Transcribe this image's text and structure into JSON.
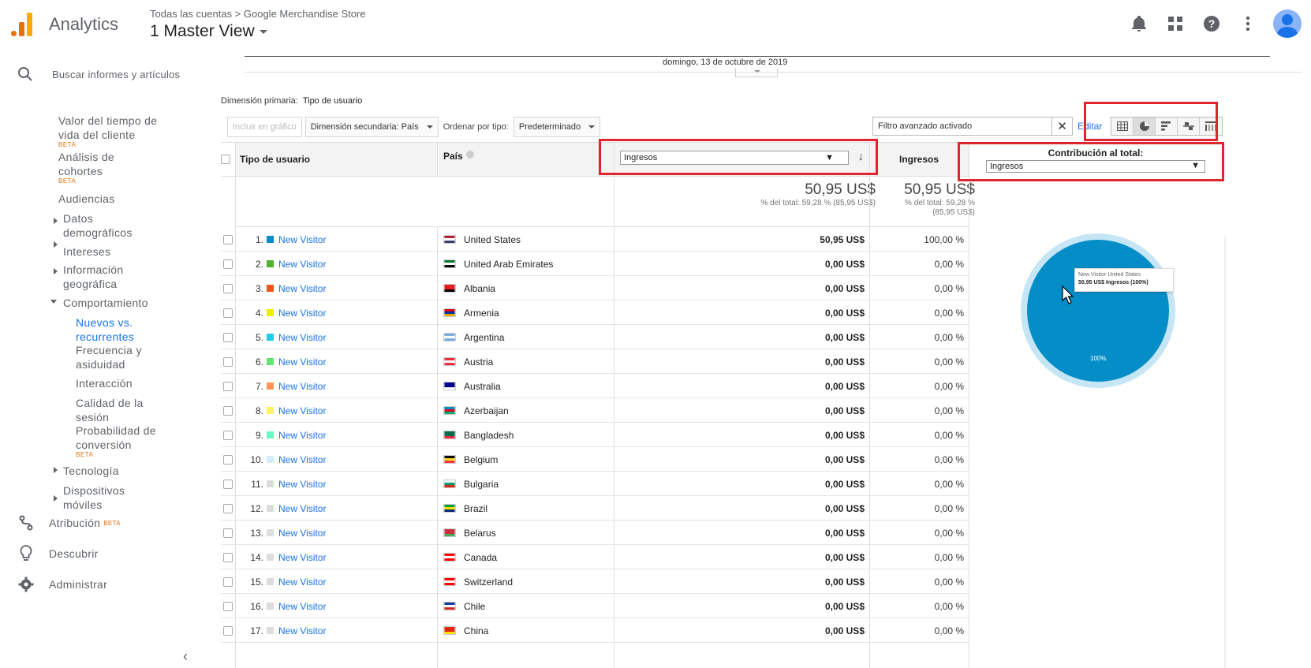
{
  "header": {
    "app_name": "Analytics",
    "breadcrumb": "Todas las cuentas > Google Merchandise Store",
    "view_name": "1 Master View",
    "icons": [
      "bell-icon",
      "apps-grid-icon",
      "help-icon",
      "more-vert-icon",
      "avatar"
    ]
  },
  "sidebar": {
    "search_label": "Buscar informes y artículos",
    "items": [
      {
        "label": "Valor del tiempo de vida del cliente",
        "beta": "BETA"
      },
      {
        "label": "Análisis de cohortes",
        "beta": "BETA"
      },
      {
        "label": "Audiencias"
      },
      {
        "label": "Datos demográficos"
      },
      {
        "label": "Intereses"
      },
      {
        "label": "Información geográfica"
      },
      {
        "label": "Comportamiento"
      },
      {
        "label": "Nuevos vs. recurrentes"
      },
      {
        "label": "Frecuencia y asiduidad"
      },
      {
        "label": "Interacción"
      },
      {
        "label": "Calidad de la sesión"
      },
      {
        "label": "Probabilidad de conversión",
        "beta": "BETA"
      },
      {
        "label": "Tecnología"
      },
      {
        "label": "Dispositivos móviles"
      }
    ],
    "bottom": {
      "attribution": "Atribución",
      "attribution_beta": "BETA",
      "discover": "Descubrir",
      "admin": "Administrar"
    }
  },
  "content": {
    "date_label": "domingo, 13 de octubre de 2019",
    "primary_dimension_label": "Dimensión primaria:",
    "primary_dimension_value": "Tipo de usuario",
    "toolbar": {
      "plot_rows": "Incluir en gráfico",
      "secondary_dimension": "Dimensión secundaria: País",
      "sort_label": "Ordenar por tipo:",
      "sort_value": "Predeterminado",
      "filter_value": "Filtro avanzado activado",
      "edit": "Editar"
    },
    "table": {
      "col_user_type": "Tipo de usuario",
      "col_country": "País",
      "metric_select": "Ingresos",
      "col_revenue": "Ingresos",
      "contrib_title": "Contribución al total:",
      "contrib_select": "Ingresos",
      "total_revenue": "50,95 US$",
      "total_revenue_sub": "% del total: 59,28 % (85,95 US$)",
      "total_revenue2": "50,95 US$",
      "total_revenue2_sub1": "% del total: 59,28 %",
      "total_revenue2_sub2": "(85,95 US$)",
      "rows": [
        {
          "idx": "1.",
          "user": "New Visitor",
          "country": "United States",
          "revenue": "50,95 US$",
          "pct": "100,00 %",
          "color": "#058dc7"
        },
        {
          "idx": "2.",
          "user": "New Visitor",
          "country": "United Arab Emirates",
          "revenue": "0,00 US$",
          "pct": "0,00 %",
          "color": "#50b432"
        },
        {
          "idx": "3.",
          "user": "New Visitor",
          "country": "Albania",
          "revenue": "0,00 US$",
          "pct": "0,00 %",
          "color": "#ed561b"
        },
        {
          "idx": "4.",
          "user": "New Visitor",
          "country": "Armenia",
          "revenue": "0,00 US$",
          "pct": "0,00 %",
          "color": "#edef00"
        },
        {
          "idx": "5.",
          "user": "New Visitor",
          "country": "Argentina",
          "revenue": "0,00 US$",
          "pct": "0,00 %",
          "color": "#24cbe5"
        },
        {
          "idx": "6.",
          "user": "New Visitor",
          "country": "Austria",
          "revenue": "0,00 US$",
          "pct": "0,00 %",
          "color": "#64e572"
        },
        {
          "idx": "7.",
          "user": "New Visitor",
          "country": "Australia",
          "revenue": "0,00 US$",
          "pct": "0,00 %",
          "color": "#ff9655"
        },
        {
          "idx": "8.",
          "user": "New Visitor",
          "country": "Azerbaijan",
          "revenue": "0,00 US$",
          "pct": "0,00 %",
          "color": "#fff263"
        },
        {
          "idx": "9.",
          "user": "New Visitor",
          "country": "Bangladesh",
          "revenue": "0,00 US$",
          "pct": "0,00 %",
          "color": "#6af9c4"
        },
        {
          "idx": "10.",
          "user": "New Visitor",
          "country": "Belgium",
          "revenue": "0,00 US$",
          "pct": "0,00 %",
          "color": "#d6ebfb"
        },
        {
          "idx": "11.",
          "user": "New Visitor",
          "country": "Bulgaria",
          "revenue": "0,00 US$",
          "pct": "0,00 %",
          "color": "#dddddd"
        },
        {
          "idx": "12.",
          "user": "New Visitor",
          "country": "Brazil",
          "revenue": "0,00 US$",
          "pct": "0,00 %",
          "color": "#dddddd"
        },
        {
          "idx": "13.",
          "user": "New Visitor",
          "country": "Belarus",
          "revenue": "0,00 US$",
          "pct": "0,00 %",
          "color": "#dddddd"
        },
        {
          "idx": "14.",
          "user": "New Visitor",
          "country": "Canada",
          "revenue": "0,00 US$",
          "pct": "0,00 %",
          "color": "#dddddd"
        },
        {
          "idx": "15.",
          "user": "New Visitor",
          "country": "Switzerland",
          "revenue": "0,00 US$",
          "pct": "0,00 %",
          "color": "#dddddd"
        },
        {
          "idx": "16.",
          "user": "New Visitor",
          "country": "Chile",
          "revenue": "0,00 US$",
          "pct": "0,00 %",
          "color": "#dddddd"
        },
        {
          "idx": "17.",
          "user": "New Visitor",
          "country": "China",
          "revenue": "0,00 US$",
          "pct": "0,00 %",
          "color": "#dddddd"
        }
      ]
    },
    "pie": {
      "tooltip_line1": "New Visitor United States",
      "tooltip_line2": "50,95 US$ Ingresos (100%)",
      "slice_label": "100%",
      "slice_value": 100,
      "slice_color": "#058dc7",
      "ring_color": "#c6e6f5"
    }
  }
}
